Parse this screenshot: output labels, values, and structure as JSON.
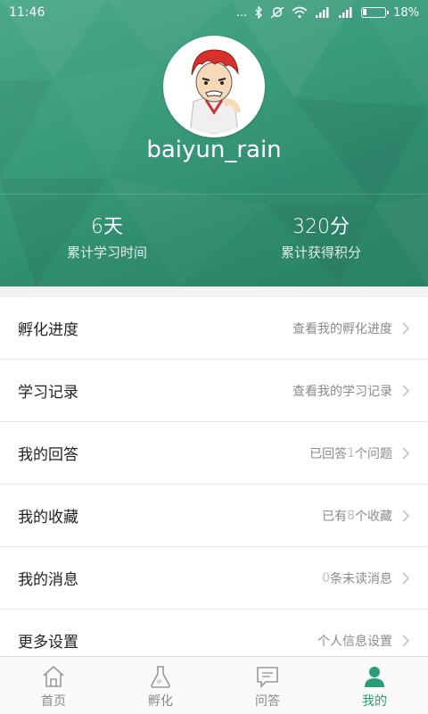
{
  "status_bar": {
    "time": "11:46",
    "dots": "...",
    "battery_percent": "18%",
    "battery_level": 0.18
  },
  "profile": {
    "username": "baiyun_rain",
    "stats": [
      {
        "num": "6",
        "unit": "天",
        "label": "累计学习时间"
      },
      {
        "num": "320",
        "unit": "分",
        "label": "累计获得积分"
      }
    ]
  },
  "menu": [
    {
      "title": "孵化进度",
      "detail_pre": "查看我的孵化进度",
      "detail_num": "",
      "detail_post": ""
    },
    {
      "title": "学习记录",
      "detail_pre": "查看我的学习记录",
      "detail_num": "",
      "detail_post": ""
    },
    {
      "title": "我的回答",
      "detail_pre": "已回答",
      "detail_num": "1",
      "detail_post": "个问题"
    },
    {
      "title": "我的收藏",
      "detail_pre": "已有",
      "detail_num": "8",
      "detail_post": "个收藏"
    },
    {
      "title": "我的消息",
      "detail_pre": "",
      "detail_num": "0",
      "detail_post": "条未读消息"
    },
    {
      "title": "更多设置",
      "detail_pre": "个人信息设置",
      "detail_num": "",
      "detail_post": ""
    }
  ],
  "tabs": [
    {
      "label": "首页",
      "icon": "home-icon",
      "active": false
    },
    {
      "label": "孵化",
      "icon": "flask-icon",
      "active": false
    },
    {
      "label": "问答",
      "icon": "message-icon",
      "active": false
    },
    {
      "label": "我的",
      "icon": "person-icon",
      "active": true
    }
  ],
  "colors": {
    "header_green": "#3a9a7c",
    "accent_green": "#2a9d78",
    "inactive_tab": "#888888"
  }
}
